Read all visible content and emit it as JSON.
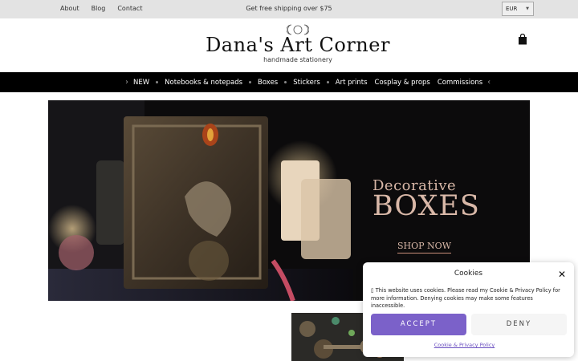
{
  "topbar": {
    "links": [
      "About",
      "Blog",
      "Contact"
    ],
    "shipping_text": "Get free shipping over $75",
    "currency": "EUR"
  },
  "header": {
    "title": "Dana's Art Corner",
    "subtitle": "handmade stationery"
  },
  "nav": {
    "items": [
      "NEW",
      "Notebooks & notepads",
      "Boxes",
      "Stickers",
      "Art prints",
      "Cosplay & props",
      "Commissions"
    ]
  },
  "hero": {
    "title_line1": "Decorative",
    "title_line2": "BOXES",
    "button_label": "SHOP NOW"
  },
  "cookie": {
    "title": "Cookies",
    "text": "▯ This website uses cookies. Please read my Cookie & Privacy Policy for more information. Denying cookies may make some features inaccessible.",
    "accept_label": "ACCEPT",
    "deny_label": "DENY",
    "policy_link": "Cookie & Privacy Policy"
  },
  "colors": {
    "accent": "#7b61c9",
    "nav_bg": "#000000",
    "topbar_bg": "#e3e3e3",
    "hero_text": "#d9b8a8"
  },
  "icons": [
    "moon-phases-icon",
    "shopping-bag-icon",
    "chevron-left-icon",
    "chevron-right-icon",
    "close-icon",
    "chevron-down-icon"
  ]
}
